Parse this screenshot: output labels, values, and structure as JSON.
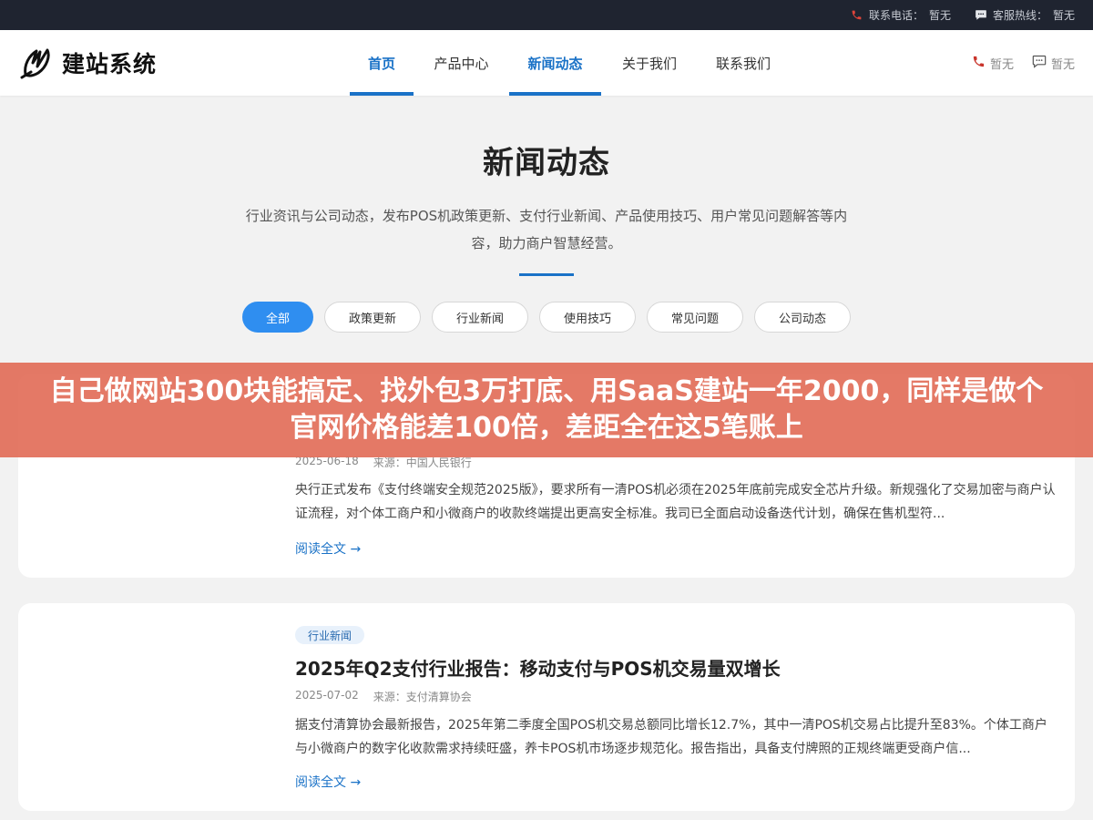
{
  "topbar": {
    "phone_label": "联系电话：",
    "phone_value": "暂无",
    "hotline_label": "客服热线：",
    "hotline_value": "暂无"
  },
  "brand": {
    "name": "建站系统"
  },
  "nav": {
    "items": [
      {
        "label": "首页"
      },
      {
        "label": "产品中心"
      },
      {
        "label": "新闻动态"
      },
      {
        "label": "关于我们"
      },
      {
        "label": "联系我们"
      }
    ]
  },
  "header_right": {
    "phone": "暂无",
    "chat": "暂无"
  },
  "hero": {
    "title": "新闻动态",
    "description": "行业资讯与公司动态，发布POS机政策更新、支付行业新闻、产品使用技巧、用户常见问题解答等内容，助力商户智慧经营。"
  },
  "filters": [
    {
      "label": "全部"
    },
    {
      "label": "政策更新"
    },
    {
      "label": "行业新闻"
    },
    {
      "label": "使用技巧"
    },
    {
      "label": "常见问题"
    },
    {
      "label": "公司动态"
    }
  ],
  "articles": [
    {
      "date": "2025-06-18",
      "source": "来源：中国人民银行",
      "summary": "央行正式发布《支付终端安全规范2025版》，要求所有一清POS机必须在2025年底前完成安全芯片升级。新规强化了交易加密与商户认证流程，对个体工商户和小微商户的收款终端提出更高安全标准。我司已全面启动设备迭代计划，确保在售机型符...",
      "more": "阅读全文 →"
    },
    {
      "tag": "行业新闻",
      "title": "2025年Q2支付行业报告：移动支付与POS机交易量双增长",
      "date": "2025-07-02",
      "source": "来源：支付清算协会",
      "summary": "据支付清算协会最新报告，2025年第二季度全国POS机交易总额同比增长12.7%，其中一清POS机交易占比提升至83%。个体工商户与小微商户的数字化收款需求持续旺盛，养卡POS机市场逐步规范化。报告指出，具备支付牌照的正规终端更受商户信...",
      "more": "阅读全文 →"
    }
  ],
  "banner": {
    "text": "自己做网站300块能搞定、找外包3万打底、用SaaS建站一年2000，同样是做个官网价格能差100倍，差距全在这5笔账上"
  },
  "colors": {
    "primary": "#1a72c7",
    "chip_active": "#2f8ef0",
    "topbar_bg": "#1f2430",
    "banner_bg": "#e26f5a"
  }
}
